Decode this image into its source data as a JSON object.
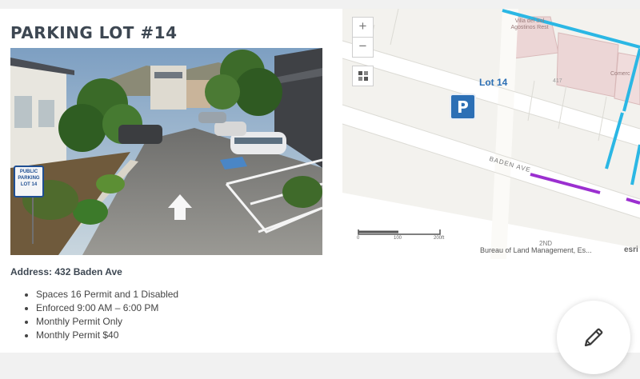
{
  "lot": {
    "title": "PARKING LOT #14",
    "address": "Address: 432 Baden Ave",
    "details": [
      "Spaces 16 Permit and 1 Disabled",
      "Enforced 9:00 AM – 6:00 PM",
      "Monthly Permit Only",
      "Monthly Permit $40"
    ]
  },
  "photo": {
    "sign_lines": [
      "PUBLIC",
      "PARKING",
      "LOT 14"
    ]
  },
  "map": {
    "zoom_in": "+",
    "zoom_out": "−",
    "lot_label": "Lot 14",
    "parking_symbol": "P",
    "street_label": "BADEN AVE",
    "street_label_2": "2ND",
    "building_label": "Villa del Sol Agostinos Rest",
    "building_label_2": "Comerc",
    "number_label": "417",
    "scale_labels": [
      "0",
      "100",
      "200ft"
    ],
    "attribution": "Bureau of Land Management, Es...",
    "esri": "esri",
    "colors": {
      "base": "#f3f2ee",
      "road": "#ffffff",
      "building": "#ecd6d6",
      "blue_line": "#2bb7e4",
      "purple_line": "#9b2fd0",
      "lot_label": "#2c6fb5",
      "parking_symbol_bg": "#2c6fb5"
    },
    "icons": [
      "zoom-in-icon",
      "zoom-out-icon",
      "layers-icon",
      "parking-icon"
    ]
  },
  "fab": {
    "icon": "pencil-icon"
  }
}
